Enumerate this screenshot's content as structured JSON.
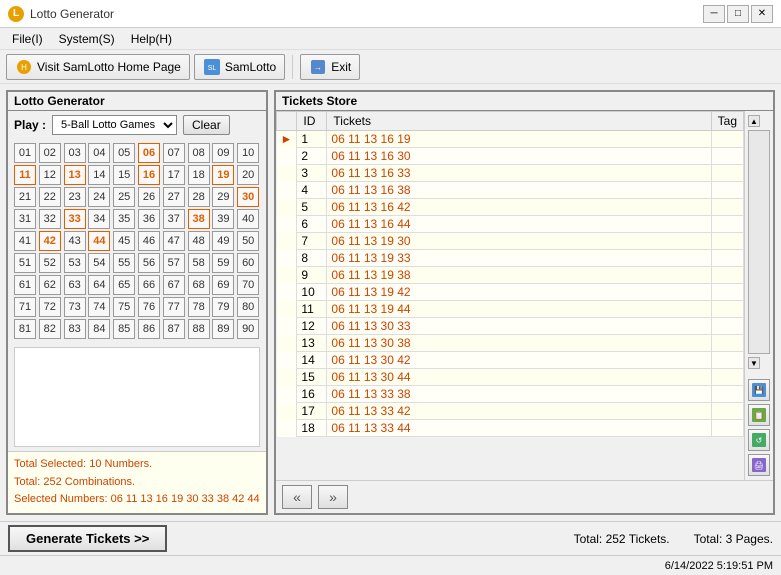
{
  "titleBar": {
    "title": "Lotto Generator",
    "minimizeLabel": "─",
    "maximizeLabel": "□",
    "closeLabel": "✕"
  },
  "menuBar": {
    "items": [
      {
        "label": "File(I)"
      },
      {
        "label": "System(S)"
      },
      {
        "label": "Help(H)"
      }
    ]
  },
  "toolbar": {
    "homePageBtn": "Visit SamLotto Home Page",
    "samLottoBtn": "SamLotto",
    "exitBtn": "Exit"
  },
  "leftPanel": {
    "title": "Lotto Generator",
    "playLabel": "Play :",
    "gameSelect": "5-Ball Lotto Games",
    "clearBtn": "Clear",
    "numbers": [
      "01",
      "02",
      "03",
      "04",
      "05",
      "06",
      "07",
      "08",
      "09",
      "10",
      "11",
      "12",
      "13",
      "14",
      "15",
      "16",
      "17",
      "18",
      "19",
      "20",
      "21",
      "22",
      "23",
      "24",
      "25",
      "26",
      "27",
      "28",
      "29",
      "30",
      "31",
      "32",
      "33",
      "34",
      "35",
      "36",
      "37",
      "38",
      "39",
      "40",
      "41",
      "42",
      "43",
      "44",
      "45",
      "46",
      "47",
      "48",
      "49",
      "50",
      "51",
      "52",
      "53",
      "54",
      "55",
      "56",
      "57",
      "58",
      "59",
      "60",
      "61",
      "62",
      "63",
      "64",
      "65",
      "66",
      "67",
      "68",
      "69",
      "70",
      "71",
      "72",
      "73",
      "74",
      "75",
      "76",
      "77",
      "78",
      "79",
      "80",
      "81",
      "82",
      "83",
      "84",
      "85",
      "86",
      "87",
      "88",
      "89",
      "90"
    ],
    "selectedNumbers": [
      "06",
      "11",
      "13",
      "16",
      "19",
      "30",
      "33",
      "38",
      "42",
      "44"
    ],
    "statsLine1": "Total Selected: 10 Numbers.",
    "statsLine2": "Total: 252 Combinations.",
    "statsLine3": "Selected Numbers: 06 11 13 16 19 30 33 38 42 44"
  },
  "rightPanel": {
    "title": "Tickets Store",
    "tableHeaders": [
      "",
      "ID",
      "Tickets",
      "Tag"
    ],
    "rows": [
      {
        "id": "1",
        "tickets": "06 11 13 16 19",
        "tag": ""
      },
      {
        "id": "2",
        "tickets": "06 11 13 16 30",
        "tag": ""
      },
      {
        "id": "3",
        "tickets": "06 11 13 16 33",
        "tag": ""
      },
      {
        "id": "4",
        "tickets": "06 11 13 16 38",
        "tag": ""
      },
      {
        "id": "5",
        "tickets": "06 11 13 16 42",
        "tag": ""
      },
      {
        "id": "6",
        "tickets": "06 11 13 16 44",
        "tag": ""
      },
      {
        "id": "7",
        "tickets": "06 11 13 19 30",
        "tag": ""
      },
      {
        "id": "8",
        "tickets": "06 11 13 19 33",
        "tag": ""
      },
      {
        "id": "9",
        "tickets": "06 11 13 19 38",
        "tag": ""
      },
      {
        "id": "10",
        "tickets": "06 11 13 19 42",
        "tag": ""
      },
      {
        "id": "11",
        "tickets": "06 11 13 19 44",
        "tag": ""
      },
      {
        "id": "12",
        "tickets": "06 11 13 30 33",
        "tag": ""
      },
      {
        "id": "13",
        "tickets": "06 11 13 30 38",
        "tag": ""
      },
      {
        "id": "14",
        "tickets": "06 11 13 30 42",
        "tag": ""
      },
      {
        "id": "15",
        "tickets": "06 11 13 30 44",
        "tag": ""
      },
      {
        "id": "16",
        "tickets": "06 11 13 33 38",
        "tag": ""
      },
      {
        "id": "17",
        "tickets": "06 11 13 33 42",
        "tag": ""
      },
      {
        "id": "18",
        "tickets": "06 11 13 33 44",
        "tag": ""
      }
    ],
    "navPrevLabel": "«",
    "navNextLabel": "»"
  },
  "bottomBar": {
    "generateBtn": "Generate Tickets >>",
    "totalTickets": "Total: 252 Tickets.",
    "totalPages": "Total: 3 Pages."
  },
  "statusBar": {
    "datetime": "6/14/2022  5:19:51 PM"
  }
}
